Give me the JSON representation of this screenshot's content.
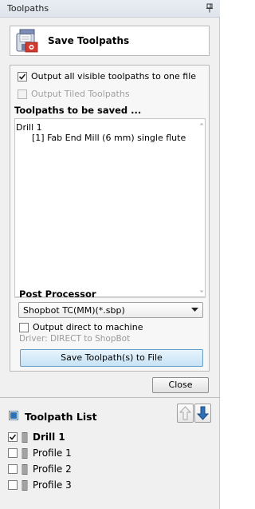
{
  "window": {
    "title": "Toolpaths"
  },
  "header": {
    "title": "Save Toolpaths"
  },
  "options": {
    "output_all_label": "Output all visible toolpaths to one file",
    "output_all_checked": true,
    "output_tiled_label": "Output Tiled Toolpaths",
    "output_tiled_checked": false,
    "output_tiled_enabled": false
  },
  "saved_list": {
    "title": "Toolpaths to be saved ...",
    "lines": [
      "Drill 1",
      "[1] Fab End Mill (6 mm) single flute"
    ]
  },
  "post_processor": {
    "title": "Post Processor",
    "selected": "Shopbot TC(MM)(*.sbp)",
    "output_direct_label": "Output direct to machine",
    "output_direct_checked": false,
    "driver_text": "Driver: DIRECT to ShopBot",
    "save_button_label": "Save Toolpath(s) to File"
  },
  "close_button_label": "Close",
  "toolpath_list": {
    "title": "Toolpath List",
    "items": [
      {
        "label": "Drill 1",
        "checked": true,
        "bold": true
      },
      {
        "label": "Profile 1",
        "checked": false,
        "bold": false
      },
      {
        "label": "Profile 2",
        "checked": false,
        "bold": false
      },
      {
        "label": "Profile 3",
        "checked": false,
        "bold": false
      }
    ]
  },
  "icons": {
    "pin": "pin-icon",
    "save_toolpaths": "floppy-disk-icon",
    "move_up": "arrow-up-icon",
    "move_down": "arrow-down-icon",
    "tool": "end-mill-icon",
    "toolpath_list": "blue-square-icon"
  },
  "colors": {
    "accent_blue": "#2f6fb5",
    "button_blue": "#c7e3f6",
    "disabled_text": "#a0a0a0"
  }
}
